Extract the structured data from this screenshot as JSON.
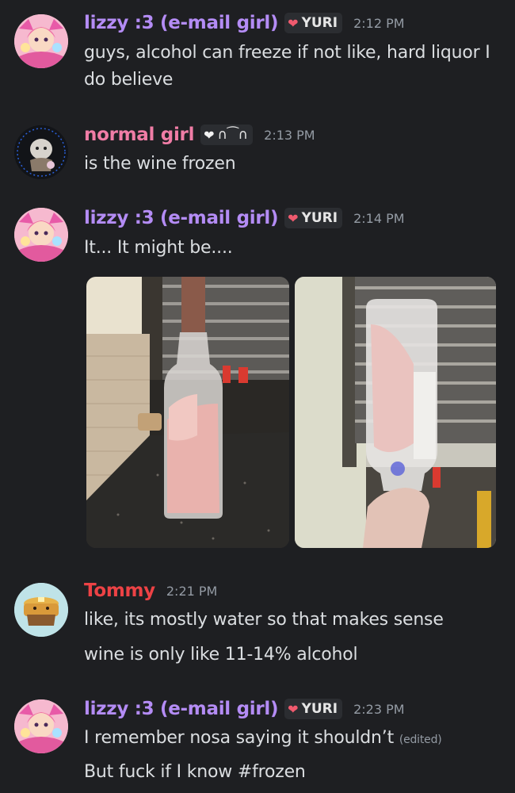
{
  "colors": {
    "background": "#1e1f22",
    "lizzy_name": "#b48cf5",
    "normal_girl_name": "#f07da6",
    "tommy_name": "#ed4245",
    "timestamp": "#949ba4"
  },
  "messages": [
    {
      "author": "lizzy :3 (e-mail girl)",
      "tag_icon": "heart-icon",
      "tag": "YURI",
      "time": "2:12 PM",
      "lines": [
        "guys, alcohol can freeze if not like, hard liquor I",
        "do believe"
      ]
    },
    {
      "author": "normal girl",
      "tag_icon": "heart-icon",
      "tag": "∩⁀∩",
      "time": "2:13 PM",
      "lines": [
        "is the wine frozen"
      ]
    },
    {
      "author": "lizzy :3 (e-mail girl)",
      "tag_icon": "heart-icon",
      "tag": "YURI",
      "time": "2:14 PM",
      "lines": [
        "It... It might be...."
      ],
      "attachments": [
        "photo-frozen-wine-bottle-upright",
        "photo-frozen-wine-bottle-upside-down"
      ]
    },
    {
      "author": "Tommy",
      "time": "2:21 PM",
      "lines": [
        "like, its mostly water so that makes sense",
        "wine is only like 11-14% alcohol"
      ]
    },
    {
      "author": "lizzy :3 (e-mail girl)",
      "tag_icon": "heart-icon",
      "tag": "YURI",
      "time": "2:23 PM",
      "lines": [
        "I remember nosa saying it shouldn’t",
        "But fuck if I know #frozen"
      ],
      "edited_label": "(edited)"
    }
  ]
}
